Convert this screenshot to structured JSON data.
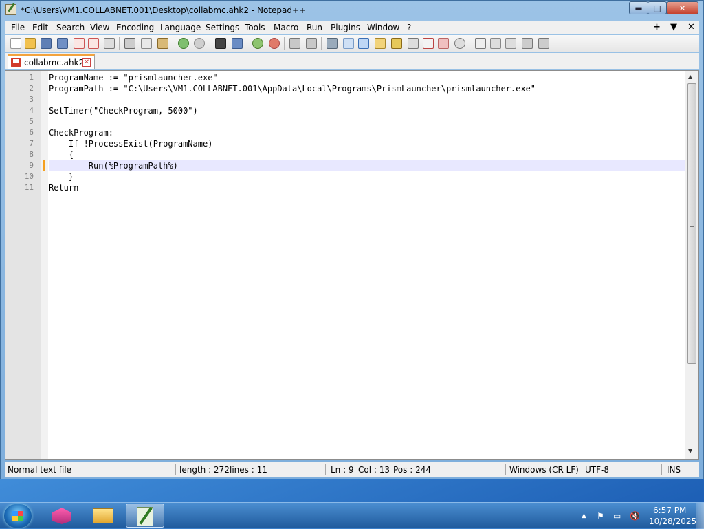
{
  "window": {
    "title": "*C:\\Users\\VM1.COLLABNET.001\\Desktop\\collabmc.ahk2 - Notepad++",
    "minimize_glyph": "▬",
    "maximize_glyph": "□",
    "close_glyph": "✕"
  },
  "menubar": {
    "items": [
      "File",
      "Edit",
      "Search",
      "View",
      "Encoding",
      "Language",
      "Settings",
      "Tools",
      "Macro",
      "Run",
      "Plugins",
      "Window",
      "?"
    ],
    "right": [
      "+",
      "▼",
      "✕"
    ]
  },
  "toolbar": {
    "icons": [
      "new-file-icon",
      "open-file-icon",
      "save-icon",
      "save-all-icon",
      "close-icon",
      "close-all-icon",
      "print-icon",
      "cut-icon",
      "copy-icon",
      "paste-icon",
      "undo-icon",
      "redo-icon",
      "find-icon",
      "replace-icon",
      "zoom-in-icon",
      "zoom-out-icon",
      "sync-vertical-icon",
      "sync-horizontal-icon",
      "word-wrap-icon",
      "show-all-chars-icon",
      "indent-guide-icon",
      "user-language-icon",
      "doc-map-icon",
      "doc-list-icon",
      "function-list-icon",
      "folder-workspace-icon",
      "monitoring-icon",
      "record-macro-icon",
      "stop-macro-icon",
      "play-macro-icon",
      "run-macro-multiple-icon",
      "save-macro-icon"
    ]
  },
  "tabs": [
    {
      "label": "collabmc.ahk2",
      "close_glyph": "✕"
    }
  ],
  "editor": {
    "lines": [
      "ProgramName := \"prismlauncher.exe\"",
      "ProgramPath := \"C:\\Users\\VM1.COLLABNET.001\\AppData\\Local\\Programs\\PrismLauncher\\prismlauncher.exe\"",
      "",
      "SetTimer(\"CheckProgram, 5000\")",
      "",
      "CheckProgram:",
      "    If !ProcessExist(ProgramName)",
      "    {",
      "        Run(%ProgramPath%)",
      "    }",
      "Return"
    ],
    "line_numbers": [
      "1",
      "2",
      "3",
      "4",
      "5",
      "6",
      "7",
      "8",
      "9",
      "10",
      "11"
    ],
    "current_line": 9,
    "scroll_up_glyph": "▲",
    "scroll_down_glyph": "▼"
  },
  "statusbar": {
    "file_type": "Normal text file",
    "length": "length : 272",
    "lines": "lines : 11",
    "ln": "Ln : 9",
    "col": "Col : 13",
    "pos": "Pos : 244",
    "eol": "Windows (CR LF)",
    "encoding": "UTF-8",
    "mode": "INS"
  },
  "taskbar": {
    "tray_icons": [
      "▲",
      "⚑",
      "▭",
      "🔇"
    ],
    "time": "6:57 PM",
    "date": "10/28/2025"
  }
}
